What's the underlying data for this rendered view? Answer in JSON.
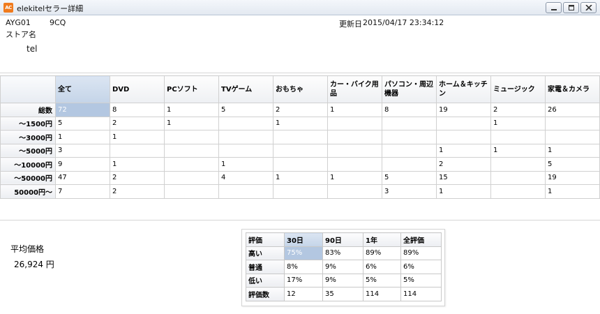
{
  "window": {
    "app_icon": "AC",
    "title": "elekitelセラー詳細"
  },
  "header": {
    "seller_id_prefix": "AYG01",
    "seller_id_suffix": "9CQ",
    "store_label": "ストア名",
    "store_name_partial": "tel",
    "updated_label": "更新日",
    "updated_value": "2015/04/17 23:34:12"
  },
  "price_table": {
    "columns": [
      "全て",
      "DVD",
      "PCソフト",
      "TVゲーム",
      "おもちゃ",
      "カー・バイク用品",
      "パソコン・周辺機器",
      "ホーム＆キッチン",
      "ミュージック",
      "家電＆カメラ"
    ],
    "rows": [
      {
        "label": "総数",
        "cells": [
          "72",
          "8",
          "1",
          "5",
          "2",
          "1",
          "8",
          "19",
          "2",
          "26"
        ]
      },
      {
        "label": "～1500円",
        "cells": [
          "5",
          "2",
          "1",
          "",
          "1",
          "",
          "",
          "",
          "1",
          ""
        ]
      },
      {
        "label": "～3000円",
        "cells": [
          "1",
          "1",
          "",
          "",
          "",
          "",
          "",
          "",
          "",
          ""
        ]
      },
      {
        "label": "～5000円",
        "cells": [
          "3",
          "",
          "",
          "",
          "",
          "",
          "",
          "1",
          "1",
          "1"
        ]
      },
      {
        "label": "～10000円",
        "cells": [
          "9",
          "1",
          "",
          "1",
          "",
          "",
          "",
          "2",
          "",
          "5"
        ]
      },
      {
        "label": "～50000円",
        "cells": [
          "47",
          "2",
          "",
          "4",
          "1",
          "1",
          "5",
          "15",
          "",
          "19"
        ]
      },
      {
        "label": "50000円～",
        "cells": [
          "7",
          "2",
          "",
          "",
          "",
          "",
          "3",
          "1",
          "",
          "1"
        ]
      }
    ]
  },
  "average_price": {
    "label": "平均価格",
    "value": "26,924 円"
  },
  "rating_table": {
    "corner": "評価",
    "columns": [
      "30日",
      "90日",
      "1年",
      "全評価"
    ],
    "rows": [
      {
        "label": "高い",
        "cells": [
          "75%",
          "83%",
          "89%",
          "89%"
        ]
      },
      {
        "label": "普通",
        "cells": [
          "8%",
          "9%",
          "6%",
          "6%"
        ]
      },
      {
        "label": "低い",
        "cells": [
          "17%",
          "9%",
          "5%",
          "5%"
        ]
      },
      {
        "label": "評価数",
        "cells": [
          "12",
          "35",
          "114",
          "114"
        ]
      }
    ]
  },
  "colors": {
    "selection": "#b3c7e1",
    "app_icon": "#f07b1e"
  }
}
